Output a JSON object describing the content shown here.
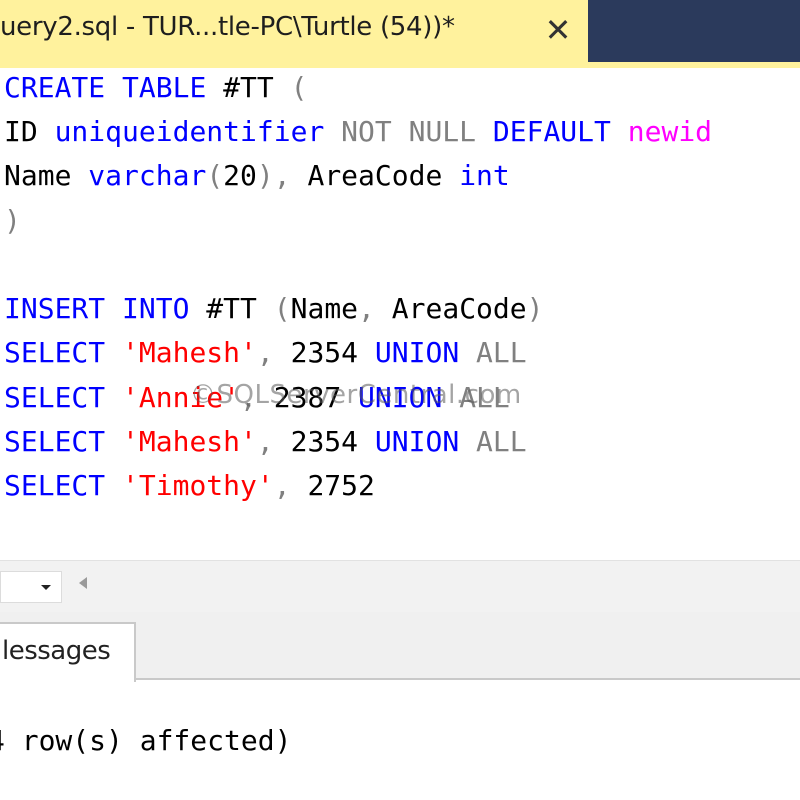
{
  "window": {
    "tab_title": "uery2.sql - TUR...tle-PC\\Turtle (54))*",
    "close_glyph": "✕"
  },
  "editor": {
    "lines": [
      [
        {
          "t": "CREATE",
          "c": "kw"
        },
        {
          "t": " ",
          "c": "txt"
        },
        {
          "t": "TABLE",
          "c": "kw"
        },
        {
          "t": " #TT ",
          "c": "txt"
        },
        {
          "t": "(",
          "c": "gray"
        }
      ],
      [
        {
          "t": "ID ",
          "c": "txt"
        },
        {
          "t": "uniqueidentifier",
          "c": "kw"
        },
        {
          "t": " ",
          "c": "txt"
        },
        {
          "t": "NOT NULL",
          "c": "gray"
        },
        {
          "t": " ",
          "c": "txt"
        },
        {
          "t": "DEFAULT",
          "c": "kw"
        },
        {
          "t": " ",
          "c": "txt"
        },
        {
          "t": "newid",
          "c": "fn"
        }
      ],
      [
        {
          "t": "Name ",
          "c": "txt"
        },
        {
          "t": "varchar",
          "c": "kw"
        },
        {
          "t": "(",
          "c": "gray"
        },
        {
          "t": "20",
          "c": "txt"
        },
        {
          "t": "),",
          "c": "gray"
        },
        {
          "t": " AreaCode ",
          "c": "txt"
        },
        {
          "t": "int",
          "c": "kw"
        }
      ],
      [
        {
          "t": ")",
          "c": "gray"
        }
      ],
      [],
      [
        {
          "t": "INSERT",
          "c": "kw"
        },
        {
          "t": " ",
          "c": "txt"
        },
        {
          "t": "INTO",
          "c": "kw"
        },
        {
          "t": " #TT ",
          "c": "txt"
        },
        {
          "t": "(",
          "c": "gray"
        },
        {
          "t": "Name",
          "c": "txt"
        },
        {
          "t": ",",
          "c": "gray"
        },
        {
          "t": " AreaCode",
          "c": "txt"
        },
        {
          "t": ")",
          "c": "gray"
        }
      ],
      [
        {
          "t": "SELECT",
          "c": "kw"
        },
        {
          "t": " ",
          "c": "txt"
        },
        {
          "t": "'Mahesh'",
          "c": "str"
        },
        {
          "t": ",",
          "c": "gray"
        },
        {
          "t": " 2354 ",
          "c": "txt"
        },
        {
          "t": "UNION",
          "c": "kw"
        },
        {
          "t": " ",
          "c": "txt"
        },
        {
          "t": "ALL",
          "c": "gray"
        }
      ],
      [
        {
          "t": "SELECT",
          "c": "kw"
        },
        {
          "t": " ",
          "c": "txt"
        },
        {
          "t": "'Annie'",
          "c": "str"
        },
        {
          "t": ",",
          "c": "gray"
        },
        {
          "t": " 2387 ",
          "c": "txt"
        },
        {
          "t": "UNION",
          "c": "kw"
        },
        {
          "t": " ",
          "c": "txt"
        },
        {
          "t": "ALL",
          "c": "gray"
        }
      ],
      [
        {
          "t": "SELECT",
          "c": "kw"
        },
        {
          "t": " ",
          "c": "txt"
        },
        {
          "t": "'Mahesh'",
          "c": "str"
        },
        {
          "t": ",",
          "c": "gray"
        },
        {
          "t": " 2354 ",
          "c": "txt"
        },
        {
          "t": "UNION",
          "c": "kw"
        },
        {
          "t": " ",
          "c": "txt"
        },
        {
          "t": "ALL",
          "c": "gray"
        }
      ],
      [
        {
          "t": "SELECT",
          "c": "kw"
        },
        {
          "t": " ",
          "c": "txt"
        },
        {
          "t": "'Timothy'",
          "c": "str"
        },
        {
          "t": ",",
          "c": "gray"
        },
        {
          "t": " 2752",
          "c": "txt"
        }
      ]
    ],
    "watermark": "©SQLServerCentral.com"
  },
  "scroll_strip": {
    "zoom_value": "",
    "dropdown_icon": "chevron-down-icon",
    "scroll_left_icon": "scroll-left-arrow-icon"
  },
  "results": {
    "messages_tab_label": "lessages",
    "message_text": "4 row(s) affected)"
  },
  "colors": {
    "keyword": "#0000ff",
    "operator": "#808080",
    "string": "#ff0000",
    "function": "#ff00ff",
    "tab_active": "#fff29d",
    "tabstrip_bg": "#2b3a5c"
  }
}
